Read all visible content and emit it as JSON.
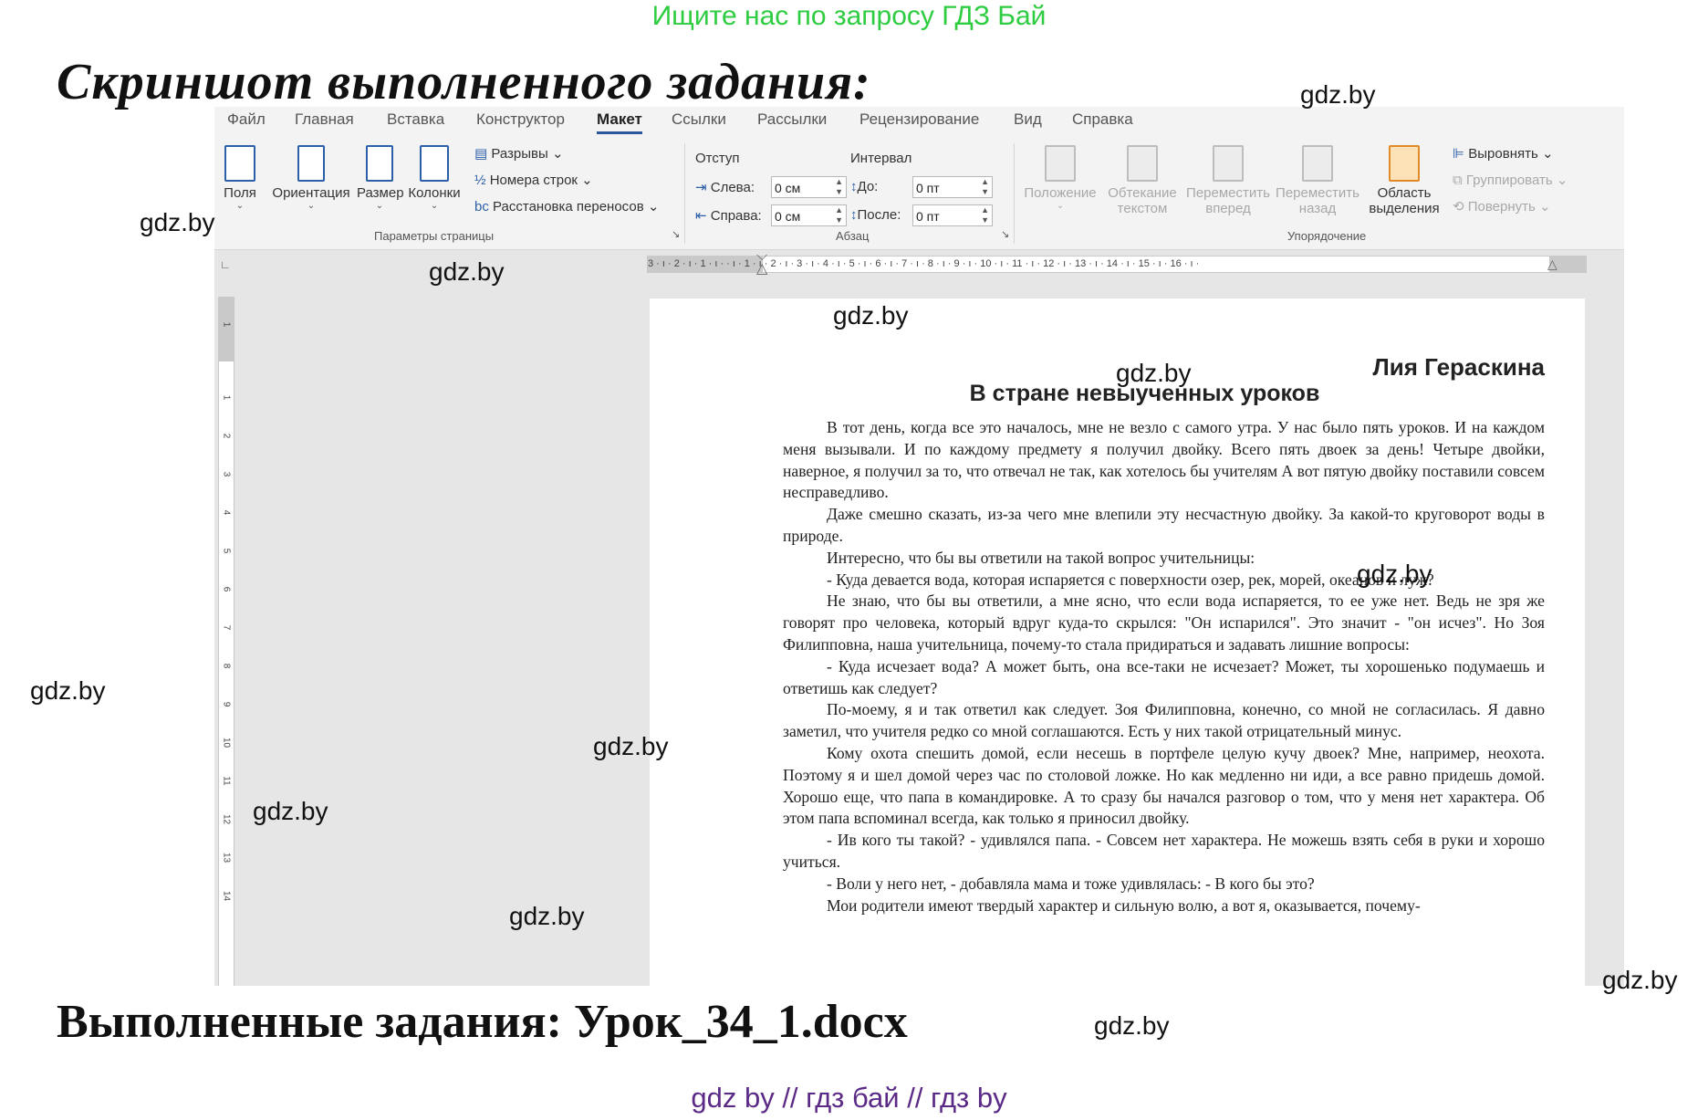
{
  "promo": "Ищите нас по запросу ГДЗ Бай",
  "heading_top": "Скриншот выполненного задания:",
  "heading_bottom": "Выполненные задания: Урок_34_1.docx",
  "watermark": "gdz.by",
  "footer": "gdz by  //  гдз бай  //  гдз by",
  "menu": [
    "Файл",
    "Главная",
    "Вставка",
    "Конструктор",
    "Макет",
    "Ссылки",
    "Рассылки",
    "Рецензирование",
    "Вид",
    "Справка"
  ],
  "menu_active": "Макет",
  "ribbon": {
    "page_setup": {
      "margins": "Поля",
      "orientation": "Ориентация",
      "size": "Размер",
      "columns": "Колонки",
      "breaks": "Разрывы",
      "line_numbers": "Номера строк",
      "hyphenation": "Расстановка переносов",
      "group_label": "Параметры страницы"
    },
    "paragraph": {
      "indent_label": "Отступ",
      "spacing_label": "Интервал",
      "left_label": "Слева:",
      "left_value": "0 см",
      "right_label": "Справа:",
      "right_value": "0 см",
      "before_label": "До:",
      "before_value": "0 пт",
      "after_label": "После:",
      "after_value": "0 пт",
      "group_label": "Абзац"
    },
    "arrange": {
      "position": "Положение",
      "wrap1": "Обтекание",
      "wrap2": "текстом",
      "forward1": "Переместить",
      "forward2": "вперед",
      "backward1": "Переместить",
      "backward2": "назад",
      "selection1": "Область",
      "selection2": "выделения",
      "align": "Выровнять",
      "group": "Группировать",
      "rotate": "Повернуть",
      "group_label": "Упорядочение"
    }
  },
  "ruler": {
    "horizontal": "3 · ı · 2 · ı · 1 · ı ·   · ı · 1 · ı · 2 · ı · 3 · ı · 4 · ı · 5 · ı · 6 · ı · 7 · ı · 8 · ı · 9 · ı · 10 · ı · 11 · ı · 12 · ı · 13 · ı · 14 · ı · 15 · ı · 16 · ı ·",
    "vertical": [
      "1",
      "1",
      "2",
      "3",
      "4",
      "5",
      "6",
      "7",
      "8",
      "9",
      "10",
      "11",
      "12",
      "13",
      "14"
    ]
  },
  "document": {
    "author": "Лия Гераскина",
    "title": "В стране невыученных уроков",
    "paragraphs": [
      "В тот день, когда все это началось, мне не везло с самого утра. У нас было пять уроков. И на каждом меня вызывали. И по каждому предмету я получил двойку. Всего пять двоек за день! Четыре двойки, наверное, я получил за то, что отвечал не так, как хотелось бы учителям А вот пятую двойку поставили совсем несправедливо.",
      "Даже смешно сказать, из-за чего мне влепили эту несчастную двойку. За какой-то круговорот воды в природе.",
      "Интересно, что бы вы ответили на такой вопрос учительницы:",
      "- Куда девается вода, которая испаряется с поверхности озер, рек, морей, океанов и луж?",
      "Не знаю, что бы вы ответили, а мне ясно, что если вода испаряется, то ее уже нет. Ведь не зря же говорят про человека, который вдруг куда-то скрылся: \"Он испарился\". Это значит - \"он исчез\". Но Зоя Филипповна, наша учительница, почему-то стала придираться и задавать лишние вопросы:",
      "- Куда исчезает вода? А может быть, она все-таки не исчезает? Может, ты хорошенько подумаешь и ответишь как следует?",
      "По-моему, я и так ответил как следует. Зоя Филипповна, конечно, со мной не согласилась. Я давно заметил, что учителя редко со мной соглашаются. Есть у них такой отрицательный минус.",
      "Кому охота спешить домой, если несешь в портфеле целую кучу двоек? Мне, например, неохота. Поэтому я и шел домой через час по столовой ложке. Но как медленно ни иди, а все равно придешь домой. Хорошо еще, что папа в командировке. А то сразу бы начался разговор о том, что у меня нет характера. Об этом папа вспоминал всегда, как только я приносил двойку.",
      "- Ив кого ты такой? - удивлялся папа. - Совсем нет характера. Не можешь взять себя в руки и хорошо учиться.",
      "- Воли у него нет, - добавляла мама и тоже удивлялась: - В кого бы это?",
      "Мои родители имеют твердый характер и сильную волю, а вот я, оказывается, почему-"
    ]
  }
}
